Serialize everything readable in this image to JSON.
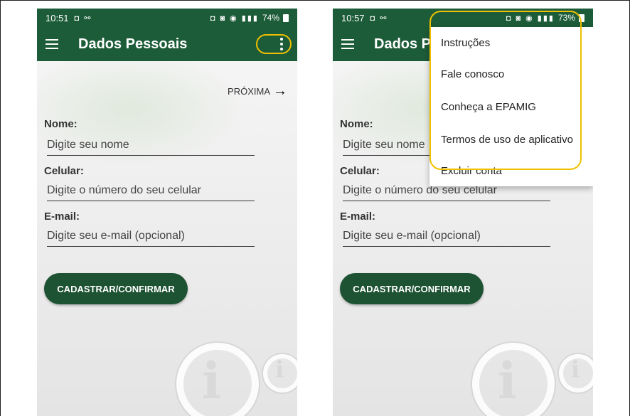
{
  "colors": {
    "app_green": "#1d5c38",
    "button_green": "#1d5232",
    "highlight": "#f0c000"
  },
  "left_screen": {
    "status": {
      "time": "10:51",
      "left_icons": "◘ ⚯",
      "right_icons": "◘ ◙ ◉ ▮▮▮",
      "battery": "74%"
    },
    "appbar": {
      "title": "Dados Pessoais"
    },
    "next_link": {
      "label": "PRÓXIMA",
      "icon": "arrow-right-icon"
    },
    "form": {
      "name_label": "Nome:",
      "name_placeholder": "Digite seu nome",
      "phone_label": "Celular:",
      "phone_placeholder": "Digite o número do seu celular",
      "email_label": "E-mail:",
      "email_placeholder": "Digite seu e-mail (opcional)"
    },
    "submit_label": "CADASTRAR/CONFIRMAR"
  },
  "right_screen": {
    "status": {
      "time": "10:57",
      "left_icons": "◘ ⚯",
      "right_icons": "◘ ◙ ◉ ▮▮▮",
      "battery": "73%"
    },
    "appbar": {
      "title": "Dados P"
    },
    "form": {
      "name_label": "Nome:",
      "name_placeholder": "Digite seu nome",
      "phone_label": "Celular:",
      "phone_placeholder": "Digite o número do seu celular",
      "email_label": "E-mail:",
      "email_placeholder": "Digite seu e-mail (opcional)"
    },
    "submit_label": "CADASTRAR/CONFIRMAR",
    "menu": {
      "items": [
        "Instruções",
        "Fale conosco",
        "Conheça a EPAMIG",
        "Termos de uso de aplicativo",
        "Excluir conta"
      ]
    }
  }
}
